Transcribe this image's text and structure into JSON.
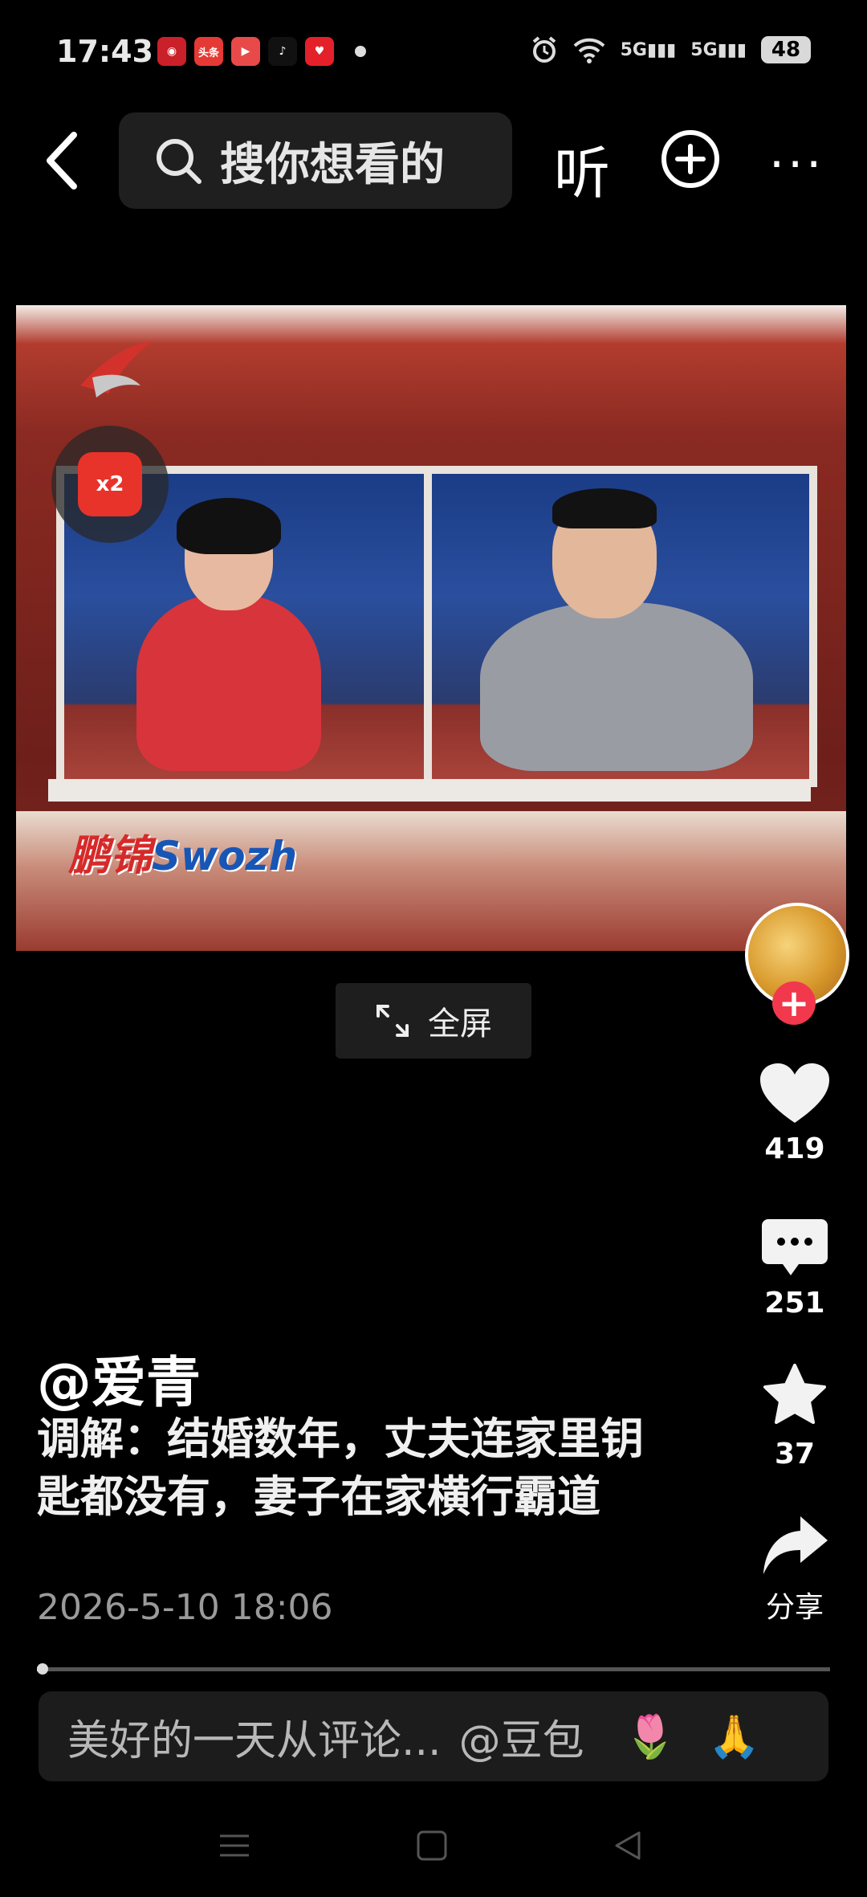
{
  "status": {
    "time": "17:43",
    "apps": [
      "头条"
    ],
    "battery": "48",
    "signal_1": "5G",
    "signal_2": "5G"
  },
  "topbar": {
    "search_placeholder": "搜你想看的",
    "listen_label": "听",
    "more_label": "···"
  },
  "video": {
    "brand_cn": "鹏锦",
    "brand_en": "Swozh",
    "badge": "x2"
  },
  "fullscreen_label": "全屏",
  "actions": {
    "like_count": "419",
    "comment_count": "251",
    "favorite_count": "37",
    "share_label": "分享"
  },
  "post": {
    "author": "@爱青",
    "description": "调解：结婚数年，丈夫连家里钥匙都没有，妻子在家横行霸道",
    "date": "2026-5-10 18:06",
    "progress": 0.005
  },
  "comment_bar": {
    "placeholder": "美好的一天从评论...",
    "mention": "@豆包",
    "emoji_1": "🌷",
    "emoji_2": "🙏"
  },
  "colors": {
    "accent_red": "#f2384c",
    "background": "#000000"
  }
}
